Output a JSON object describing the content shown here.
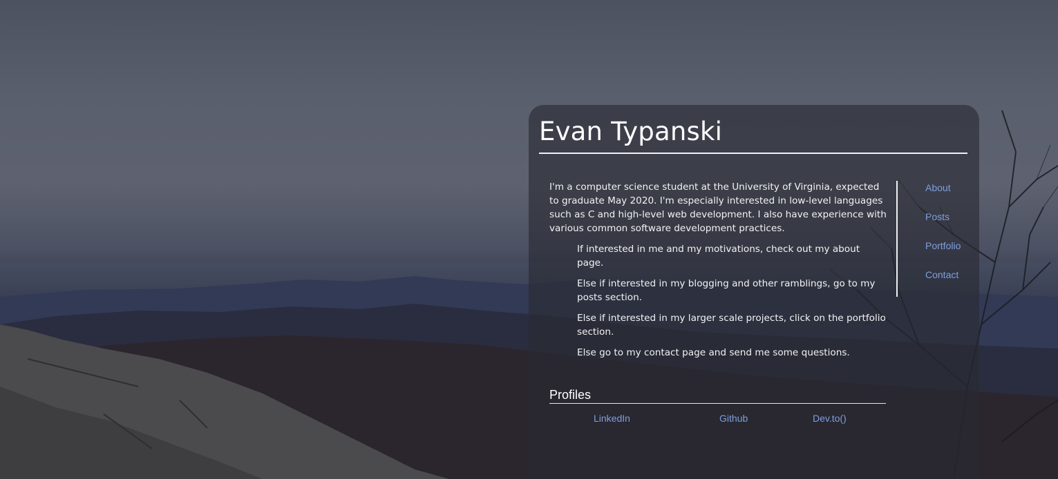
{
  "site": {
    "title": "Evan Typanski"
  },
  "intro": {
    "text": "I'm a computer science student at the University of Virginia, expected to graduate May 2020. I'm especially interested in low-level languages such as C and high-level web development. I also have experience with various common software development practices."
  },
  "branches": [
    "If interested in me and my motivations, check out my about page.",
    "Else if interested in my blogging and other ramblings, go to my posts section.",
    "Else if interested in my larger scale projects, click on the portfolio section.",
    "Else go to my contact page and send me some questions."
  ],
  "profiles": {
    "heading": "Profiles",
    "links": [
      "LinkedIn",
      "Github",
      "Dev.to()"
    ]
  },
  "nav": {
    "items": [
      "About",
      "Posts",
      "Portfolio",
      "Contact"
    ]
  },
  "colors": {
    "link": "#7f9fe0",
    "text": "#f3f3f3",
    "card": "rgba(40,42,50,0.62)"
  }
}
